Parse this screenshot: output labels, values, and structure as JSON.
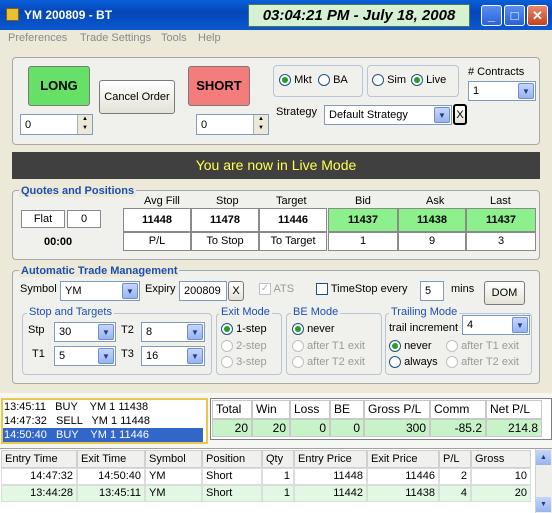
{
  "window": {
    "title": "YM 200809 - BT",
    "clock": "03:04:21 PM - July 18, 2008"
  },
  "menu": [
    "Preferences",
    "Trade Settings",
    "Tools",
    "Help"
  ],
  "order": {
    "long_label": "LONG",
    "short_label": "SHORT",
    "cancel_label": "Cancel Order",
    "long_qty": "0",
    "short_qty": "0",
    "mkt_label": "Mkt",
    "ba_label": "BA",
    "sim_label": "Sim",
    "live_label": "Live",
    "contracts_label": "# Contracts",
    "contracts_value": "1",
    "strategy_label": "Strategy",
    "strategy_value": "Default Strategy",
    "x_label": "X"
  },
  "banner": "You are now in Live Mode",
  "quotes": {
    "title": "Quotes and Positions",
    "position": "Flat",
    "position_qty": "0",
    "time": "00:00",
    "headers": [
      "Avg Fill",
      "Stop",
      "Target",
      "Bid",
      "Ask",
      "Last"
    ],
    "values": [
      "11448",
      "11478",
      "11446",
      "11437",
      "11438",
      "11437"
    ],
    "sublabels": [
      "P/L",
      "To Stop",
      "To Target"
    ],
    "subvalues": [
      "1",
      "9",
      "3"
    ]
  },
  "atm": {
    "title": "Automatic Trade Management",
    "symbol_label": "Symbol",
    "symbol_value": "YM",
    "expiry_label": "Expiry",
    "expiry_value": "200809",
    "x_label": "X",
    "ats_label": "ATS",
    "timestop_label": "TimeStop every",
    "timestop_value": "5",
    "mins_label": "mins",
    "dom_label": "DOM",
    "stops_title": "Stop and Targets",
    "stp_label": "Stp",
    "stp_value": "30",
    "t1_label": "T1",
    "t1_value": "5",
    "t2_label": "T2",
    "t2_value": "8",
    "t3_label": "T3",
    "t3_value": "16",
    "exit_title": "Exit Mode",
    "exit_1": "1-step",
    "exit_2": "2-step",
    "exit_3": "3-step",
    "be_title": "BE Mode",
    "be_1": "never",
    "be_2": "after T1 exit",
    "be_3": "after T2 exit",
    "trail_title": "Trailing Mode",
    "trail_inc_label": "trail increment",
    "trail_inc_value": "4",
    "trail_never": "never",
    "trail_t1": "after T1 exit",
    "trail_always": "always",
    "trail_t2": "after T2 exit"
  },
  "log": [
    "13:45:11   BUY    YM 1 11438",
    "14:47:32   SELL   YM 1 11448",
    "14:50:40   BUY    YM 1 11446"
  ],
  "stats": {
    "headers": [
      "Total",
      "Win",
      "Loss",
      "BE",
      "Gross P/L",
      "Comm",
      "Net P/L"
    ],
    "values": [
      "20",
      "20",
      "0",
      "0",
      "300",
      "-85.2",
      "214.8"
    ]
  },
  "trades": {
    "headers": [
      "Entry Time",
      "Exit Time",
      "Symbol",
      "Position",
      "Qty",
      "Entry Price",
      "Exit Price",
      "P/L",
      "Gross"
    ],
    "rows": [
      [
        "14:47:32",
        "14:50:40",
        "YM",
        "Short",
        "1",
        "11448",
        "11446",
        "2",
        "10"
      ],
      [
        "13:44:28",
        "13:45:11",
        "YM",
        "Short",
        "1",
        "11442",
        "11438",
        "4",
        "20"
      ]
    ]
  },
  "colors": {
    "long": "#66e066",
    "short": "#f47c7c",
    "banner_bg": "#404040",
    "banner_fg": "#ffff50",
    "title_blue": "#1c4fb0"
  }
}
